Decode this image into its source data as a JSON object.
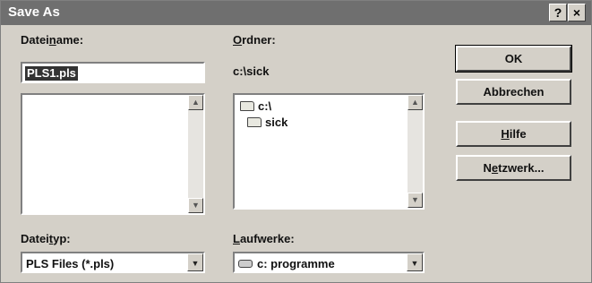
{
  "window": {
    "title": "Save As",
    "help_btn": "?",
    "close_btn": "×"
  },
  "filename": {
    "label_pre": "Datei",
    "label_accel": "n",
    "label_post": "ame:",
    "value": "PLS1.pls"
  },
  "folder": {
    "label_accel": "O",
    "label_post": "rdner:",
    "current_path": "c:\\sick",
    "tree": [
      {
        "label": "c:\\",
        "icon": "open-folder-icon"
      },
      {
        "label": "sick",
        "icon": "open-folder-icon"
      }
    ]
  },
  "filetype": {
    "label_pre": "Datei",
    "label_accel": "t",
    "label_post": "yp:",
    "selected": "PLS Files (*.pls)"
  },
  "drives": {
    "label_accel": "L",
    "label_post": "aufwerke:",
    "selected": "c: programme",
    "icon": "drive-icon"
  },
  "buttons": {
    "ok": "OK",
    "cancel": "Abbrechen",
    "help_accel": "H",
    "help_post": "ilfe",
    "network_pre": "N",
    "network_accel": "e",
    "network_post": "tzwerk..."
  }
}
